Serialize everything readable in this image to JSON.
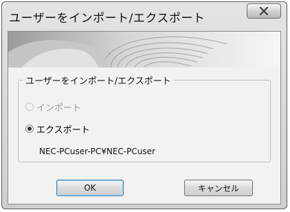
{
  "window": {
    "title": "ユーザーをインポート/エクスポート"
  },
  "group": {
    "legend": "ユーザーをインポート/エクスポート",
    "options": [
      {
        "label": "インポート",
        "selected": false,
        "enabled": false
      },
      {
        "label": "エクスポート",
        "selected": true,
        "enabled": true
      }
    ],
    "user_path": "NEC-PCuser-PC¥NEC-PCuser"
  },
  "buttons": {
    "ok_label": "OK",
    "cancel_label": "キャンセル"
  },
  "colors": {
    "close_x": "#3a3a3a",
    "ok_border": "#3c7fb1"
  },
  "icons": {
    "close": "close-icon",
    "banner": "fingerprint-banner"
  }
}
